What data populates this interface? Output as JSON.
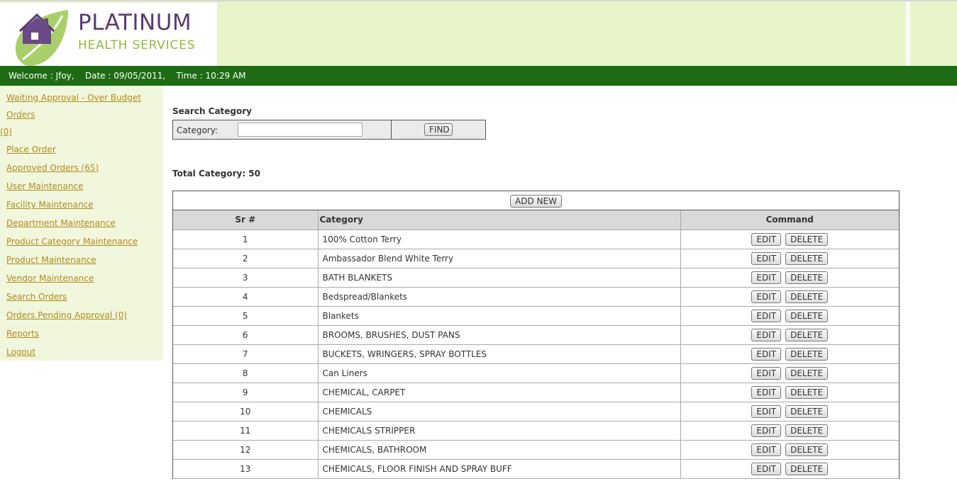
{
  "brand": {
    "title": "PLATINUM",
    "subtitle": "HEALTH SERVICES"
  },
  "welcome": {
    "user": "Welcome : Jfoy,",
    "date": "Date : 09/05/2011,",
    "time": "Time : 10:29 AM"
  },
  "sidebar": {
    "items": [
      {
        "label_line1": "Waiting Approval - Over Budget Orders",
        "label_line2": "(0)"
      },
      {
        "label": "Place Order"
      },
      {
        "label": "Approved Orders (65)"
      },
      {
        "label": "User Maintenance"
      },
      {
        "label": "Facility Maintenance"
      },
      {
        "label": "Department Maintenance"
      },
      {
        "label": "Product Category Maintenance"
      },
      {
        "label": "Product Maintenance"
      },
      {
        "label": "Vendor Maintenance"
      },
      {
        "label": "Search Orders"
      },
      {
        "label": "Orders Pending Approval (0)"
      },
      {
        "label": "Reports"
      },
      {
        "label": "Logout"
      }
    ]
  },
  "search": {
    "title": "Search Category",
    "label": "Category:",
    "value": "",
    "find_label": "FIND"
  },
  "total": "Total Category: 50",
  "grid": {
    "add_new_label": "ADD NEW",
    "headers": [
      "Sr #",
      "Category",
      "Command"
    ],
    "edit_label": "EDIT",
    "delete_label": "DELETE",
    "rows": [
      {
        "sr": "1",
        "category": "100% Cotton Terry"
      },
      {
        "sr": "2",
        "category": "Ambassador Blend White Terry"
      },
      {
        "sr": "3",
        "category": "BATH BLANKETS"
      },
      {
        "sr": "4",
        "category": "Bedspread/Blankets"
      },
      {
        "sr": "5",
        "category": "Blankets"
      },
      {
        "sr": "6",
        "category": "BROOMS, BRUSHES, DUST PANS"
      },
      {
        "sr": "7",
        "category": "BUCKETS, WRINGERS, SPRAY BOTTLES"
      },
      {
        "sr": "8",
        "category": "Can Liners"
      },
      {
        "sr": "9",
        "category": "CHEMICAL, CARPET"
      },
      {
        "sr": "10",
        "category": "CHEMICALS"
      },
      {
        "sr": "11",
        "category": "CHEMICALS STRIPPER"
      },
      {
        "sr": "12",
        "category": "CHEMICALS, BATHROOM"
      },
      {
        "sr": "13",
        "category": "CHEMICALS, FLOOR FINISH AND SPRAY BUFF"
      }
    ]
  },
  "colors": {
    "welcome_bar": "#1e6b14",
    "header_bg": "#e6f4c8",
    "sidebar_bg": "#f1f7dd",
    "link": "#b08a1e",
    "brand_purple": "#5a3a6e",
    "brand_green": "#8dbb3c"
  }
}
